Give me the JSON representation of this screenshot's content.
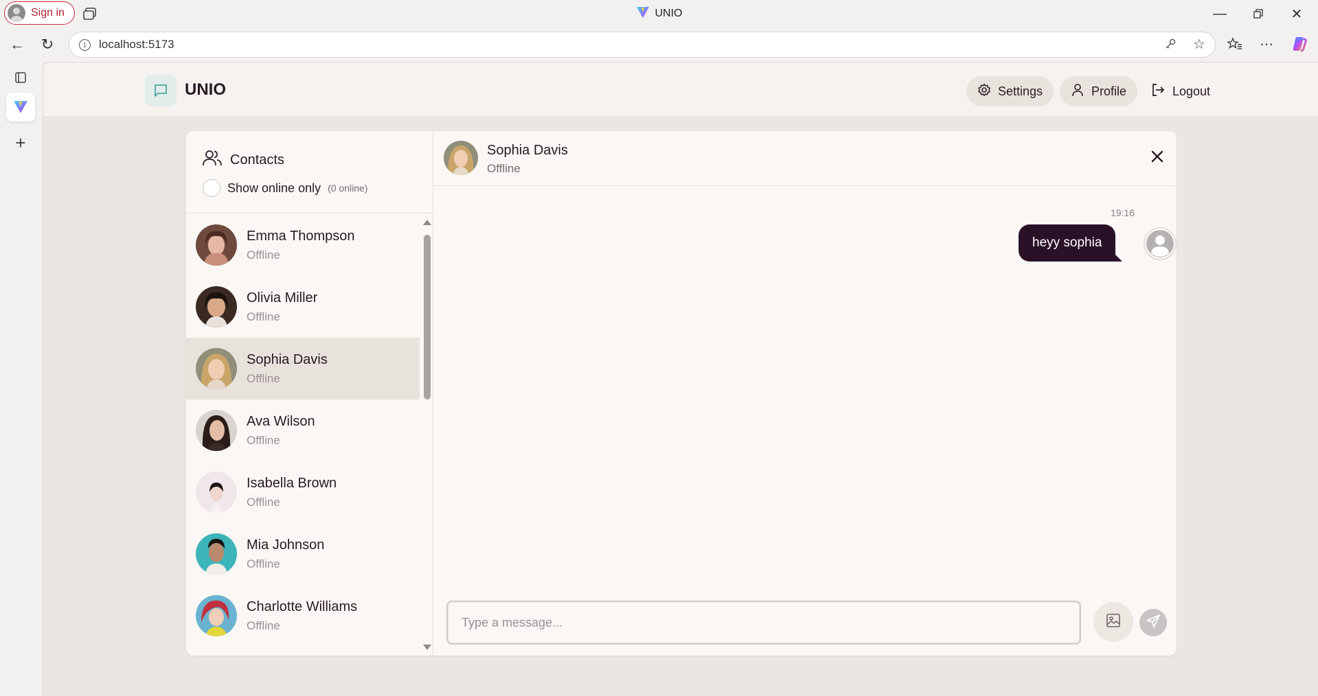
{
  "browser": {
    "signin_label": "Sign in",
    "window_title": "UNIO",
    "url": "localhost:5173",
    "icons": [
      "profile-icon",
      "tab-actions-icon",
      "minimize-icon",
      "restore-icon",
      "close-icon",
      "back-icon",
      "reload-icon",
      "info-icon",
      "key-icon",
      "star-icon",
      "favorites-icon",
      "more-icon",
      "copilot-icon",
      "vertical-tabs-icon",
      "vite-icon",
      "new-tab-icon"
    ]
  },
  "app": {
    "brand": "UNIO",
    "nav": {
      "settings": "Settings",
      "profile": "Profile",
      "logout": "Logout"
    }
  },
  "sidebar": {
    "title": "Contacts",
    "filter_label": "Show online only",
    "online_count": "(0 online)",
    "contacts": [
      {
        "name": "Emma Thompson",
        "status": "Offline"
      },
      {
        "name": "Olivia Miller",
        "status": "Offline"
      },
      {
        "name": "Sophia Davis",
        "status": "Offline"
      },
      {
        "name": "Ava Wilson",
        "status": "Offline"
      },
      {
        "name": "Isabella Brown",
        "status": "Offline"
      },
      {
        "name": "Mia Johnson",
        "status": "Offline"
      },
      {
        "name": "Charlotte Williams",
        "status": "Offline"
      }
    ]
  },
  "chat": {
    "name": "Sophia Davis",
    "status": "Offline",
    "messages": [
      {
        "time": "19:16",
        "text": "heyy sophia"
      }
    ],
    "composer_placeholder": "Type a message..."
  },
  "colors": {
    "accent": "#2b1128",
    "background": "#ebe6e1",
    "panel": "#faf7f5",
    "brand_icon_bg": "#e2ecea"
  }
}
